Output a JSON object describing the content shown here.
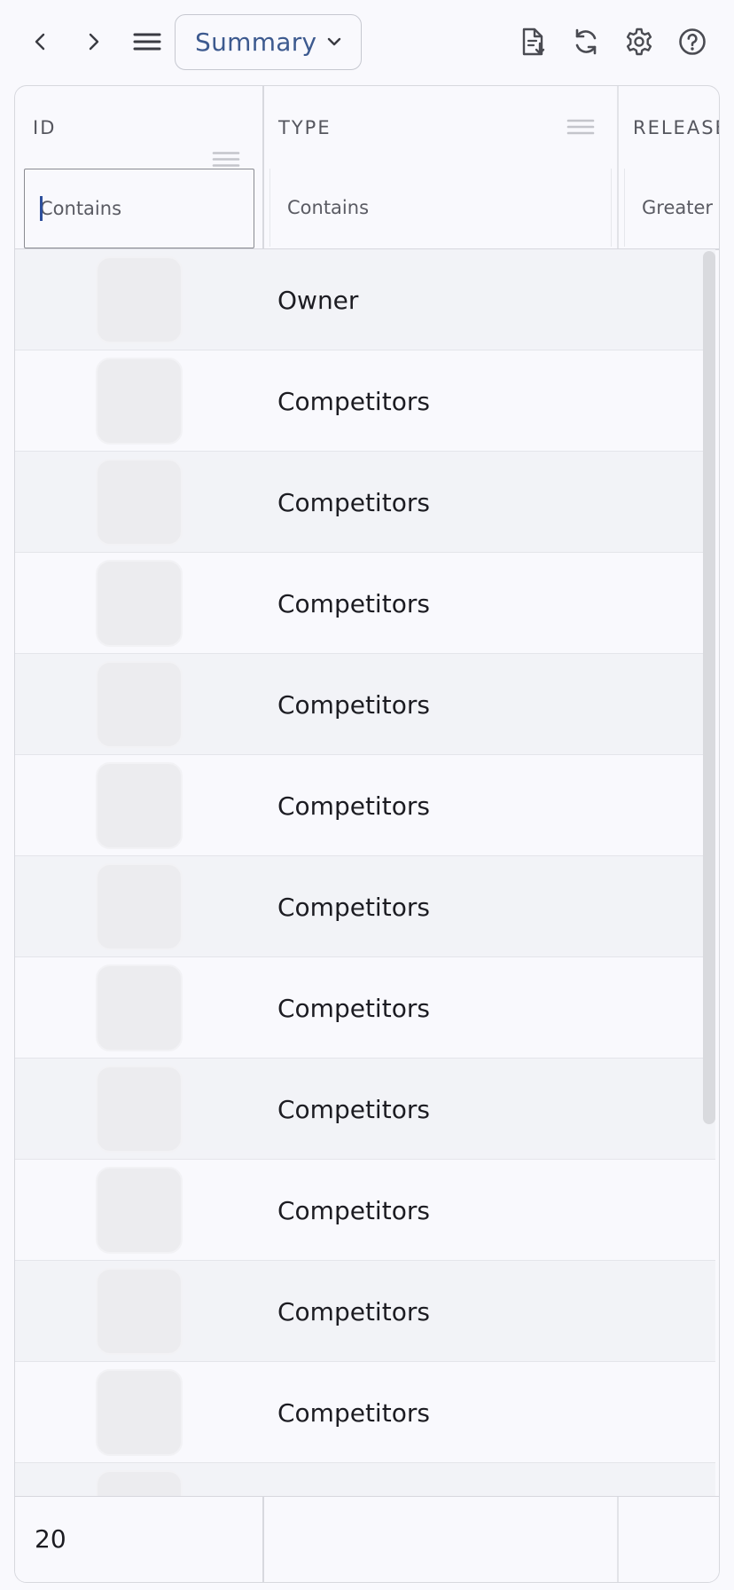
{
  "toolbar": {
    "back_icon": "chevron-left-icon",
    "forward_icon": "chevron-right-icon",
    "menu_icon": "hamburger-menu-icon",
    "view_select": {
      "selected": "Summary"
    },
    "export_icon": "document-download-icon",
    "refresh_icon": "refresh-icon",
    "settings_icon": "gear-icon",
    "help_icon": "help-circle-icon"
  },
  "grid": {
    "columns": [
      {
        "key": "id",
        "label": "ID",
        "filter_placeholder": "Contains"
      },
      {
        "key": "type",
        "label": "TYPE",
        "filter_placeholder": "Contains"
      },
      {
        "key": "release",
        "label": "RELEASE",
        "filter_placeholder": "Greater"
      }
    ],
    "rows": [
      {
        "type": "Owner"
      },
      {
        "type": "Competitors"
      },
      {
        "type": "Competitors"
      },
      {
        "type": "Competitors"
      },
      {
        "type": "Competitors"
      },
      {
        "type": "Competitors"
      },
      {
        "type": "Competitors"
      },
      {
        "type": "Competitors"
      },
      {
        "type": "Competitors"
      },
      {
        "type": "Competitors"
      },
      {
        "type": "Competitors"
      },
      {
        "type": "Competitors"
      },
      {
        "type": ""
      }
    ],
    "footer": {
      "count": "20"
    }
  },
  "colors": {
    "accent": "#3d5a8f",
    "row_alt": "#f2f3f7",
    "background": "#f9f9fd",
    "border": "#d7d8de"
  }
}
